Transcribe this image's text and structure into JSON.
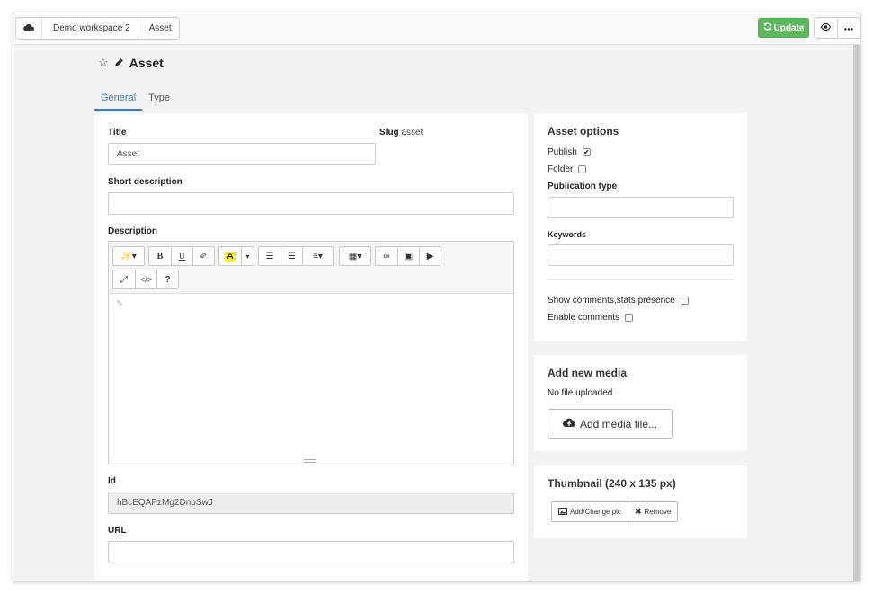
{
  "breadcrumb": {
    "home_icon": "cloud-icon",
    "items": [
      "Demo workspace 2",
      "Asset"
    ]
  },
  "header": {
    "update_label": "Update",
    "update_icon": "refresh-icon",
    "preview_icon": "eye-icon",
    "more_icon": "ellipsis-icon",
    "accent_color": "#5cb85c"
  },
  "page": {
    "title": "Asset",
    "title_icon": "pencil-icon",
    "favorite_icon": "star-outline-icon"
  },
  "tabs": [
    {
      "label": "General",
      "active": true
    },
    {
      "label": "Type",
      "active": false
    }
  ],
  "form": {
    "title_label": "Title",
    "title_value": "Asset",
    "slug_label": "Slug",
    "slug_value": "asset",
    "short_description_label": "Short description",
    "short_description_value": "",
    "description_label": "Description",
    "id_label": "Id",
    "id_value": "hBcEQAPzMg2DnpSwJ",
    "url_label": "URL",
    "url_value": ""
  },
  "editor_toolbar": {
    "style": "✨▾",
    "bold": "B",
    "underline": "U",
    "eraser": "✐",
    "font_color": "A",
    "caret": "▾",
    "ul": "☰",
    "ol": "☰",
    "align": "≡▾",
    "table": "▦▾",
    "link": "∞",
    "image": "▣",
    "video": "▶",
    "fullscreen": "⤢",
    "code": "</>",
    "help": "?"
  },
  "asset_options": {
    "title": "Asset options",
    "publish_label": "Publish",
    "publish_checked": true,
    "folder_label": "Folder",
    "folder_checked": false,
    "publication_type_label": "Publication type",
    "publication_type_value": "",
    "keywords_label": "Keywords",
    "keywords_value": "",
    "show_comments_label": "Show comments,stats,presence",
    "show_comments_checked": false,
    "enable_comments_label": "Enable comments",
    "enable_comments_checked": false
  },
  "media": {
    "title": "Add new media",
    "status": "No file uploaded",
    "add_label": "Add media file...",
    "add_icon": "cloud-upload-icon"
  },
  "thumbnail": {
    "title": "Thumbnail (240 x 135 px)",
    "add_label": "Add/Change pic",
    "add_icon": "picture-icon",
    "remove_label": "Remove",
    "remove_icon": "close-icon"
  },
  "check_mark": "✔"
}
